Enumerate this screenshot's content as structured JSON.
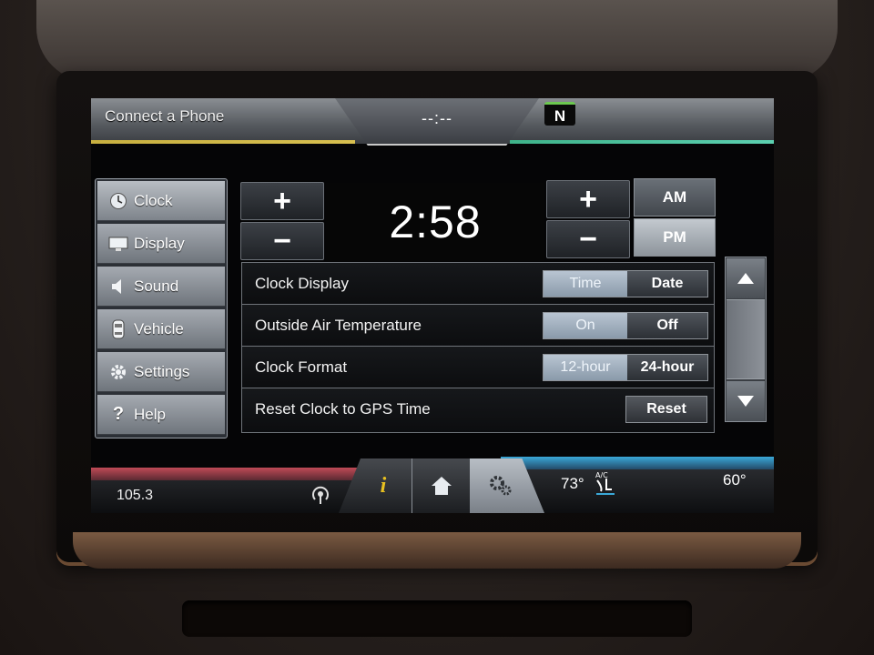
{
  "header": {
    "phone_label": "Connect a Phone",
    "clock_placeholder": "--:--",
    "compass": "N"
  },
  "menu": {
    "items": [
      {
        "label": "Clock",
        "icon": "clock-icon",
        "active": true
      },
      {
        "label": "Display",
        "icon": "display-icon"
      },
      {
        "label": "Sound",
        "icon": "speaker-icon"
      },
      {
        "label": "Vehicle",
        "icon": "vehicle-icon"
      },
      {
        "label": "Settings",
        "icon": "gear-icon"
      },
      {
        "label": "Help",
        "icon": "question-icon"
      }
    ]
  },
  "time_setter": {
    "time": "2:58",
    "plus": "+",
    "minus": "−",
    "am": "AM",
    "pm": "PM",
    "selected_period": "PM"
  },
  "settings": {
    "rows": [
      {
        "label": "Clock Display",
        "options": [
          "Time",
          "Date"
        ],
        "selected": "Time"
      },
      {
        "label": "Outside Air Temperature",
        "options": [
          "On",
          "Off"
        ],
        "selected": "On"
      },
      {
        "label": "Clock Format",
        "options": [
          "12-hour",
          "24-hour"
        ],
        "selected": "12-hour"
      },
      {
        "label": "Reset Clock to GPS Time",
        "button": "Reset"
      }
    ]
  },
  "footer": {
    "radio_frequency": "105.3",
    "outside_temp": "73°",
    "cabin_temp": "60°",
    "ac_label": "A/C"
  },
  "colors": {
    "accent_yellow": "#d8c050",
    "accent_green": "#5cd0b0",
    "accent_red": "#c04a56",
    "accent_blue": "#3aa8d8"
  }
}
